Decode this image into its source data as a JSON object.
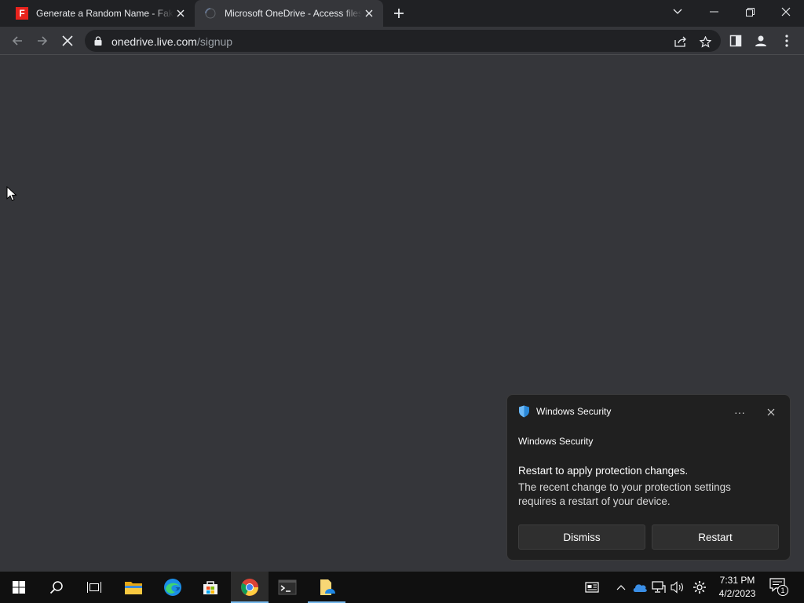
{
  "browser": {
    "tabs": [
      {
        "title": "Generate a Random Name - Fake Name Generator",
        "favicon": "F"
      },
      {
        "title": "Microsoft OneDrive - Access files anywhere",
        "favicon": "loading-spinner"
      }
    ],
    "address": {
      "host": "onedrive.live.com",
      "path": "/signup"
    }
  },
  "toast": {
    "app_name": "Windows Security",
    "subtitle": "Windows Security",
    "heading": "Restart to apply protection changes.",
    "body": "The recent change to your protection settings requires a restart of your device.",
    "more_label": "···",
    "dismiss_label": "Dismiss",
    "restart_label": "Restart"
  },
  "taskbar": {
    "apps": [
      "start-icon",
      "search-icon",
      "task-view-icon",
      "file-explorer-icon",
      "edge-icon",
      "store-icon",
      "chrome-icon",
      "terminal-icon",
      "notepad-icon"
    ],
    "clock": {
      "time": "7:31 PM",
      "date": "4/2/2023"
    },
    "notification_count": "1"
  },
  "colors": {
    "accent": "#76b9ed",
    "chrome_dark": "#202124",
    "content_bg": "#35363a",
    "toast_bg": "#202020"
  }
}
